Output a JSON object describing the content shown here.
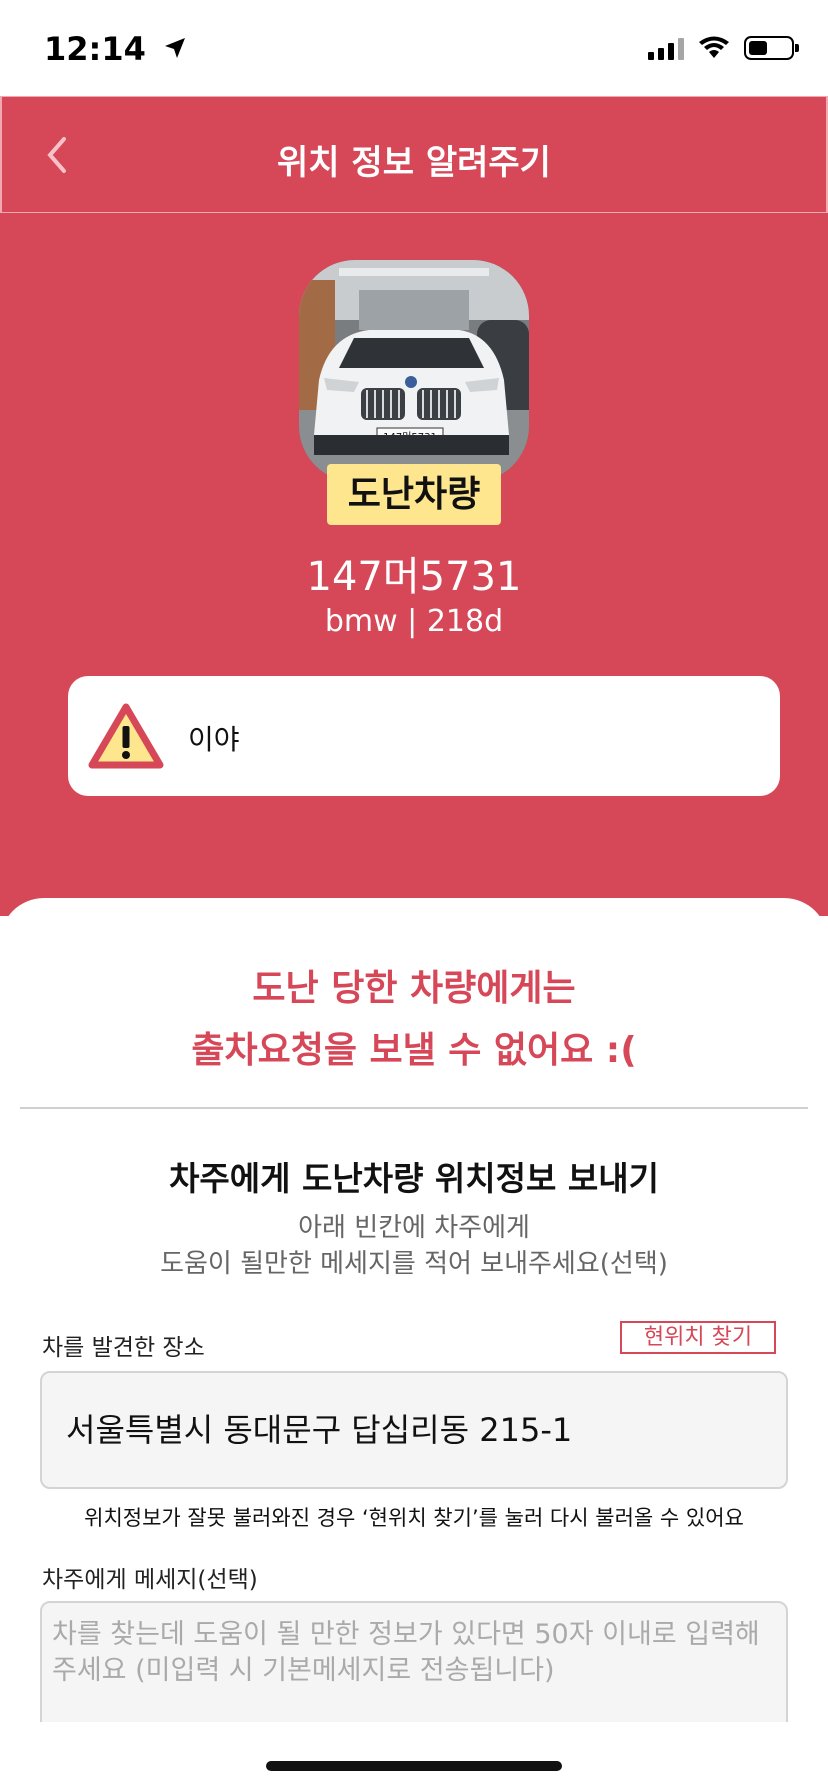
{
  "status_bar": {
    "time": "12:14",
    "icons": [
      "location-arrow-icon",
      "cellular-signal-icon",
      "wifi-icon",
      "battery-icon"
    ]
  },
  "header": {
    "title": "위치 정보 알려주기",
    "back_icon": "chevron-left-icon"
  },
  "vehicle": {
    "status_badge": "도난차량",
    "plate_number": "147머5731",
    "model": "bmw | 218d",
    "photo_plate": "147머5731"
  },
  "notice": {
    "icon": "warning-triangle-icon",
    "text": "이야"
  },
  "sheet": {
    "warning_line1": "도난 당한 차량에게는",
    "warning_line2": "출차요청을 보낼 수 없어요 :(",
    "section_title": "차주에게 도난차량 위치정보 보내기",
    "section_sub_line1": "아래 빈칸에 차주에게",
    "section_sub_line2": "도움이 될만한 메세지를 적어 보내주세요(선택)",
    "place_label": "차를 발견한 장소",
    "find_location_button": "현위치 찾기",
    "address_value": "서울특별시 동대문구 답십리동 215-1",
    "address_hint": "위치정보가 잘못 불러와진 경우 ‘현위치 찾기’를 눌러 다시 불러올 수 있어요",
    "message_label": "차주에게 메세지(선택)",
    "message_placeholder": "차를 찾는데 도움이 될 만한 정보가 있다면 50자 이내로 입력해주세요 (미입력 시 기본메세지로 전송됩니다)"
  },
  "colors": {
    "brand_red": "#d64758",
    "badge_yellow": "#fde68e"
  }
}
